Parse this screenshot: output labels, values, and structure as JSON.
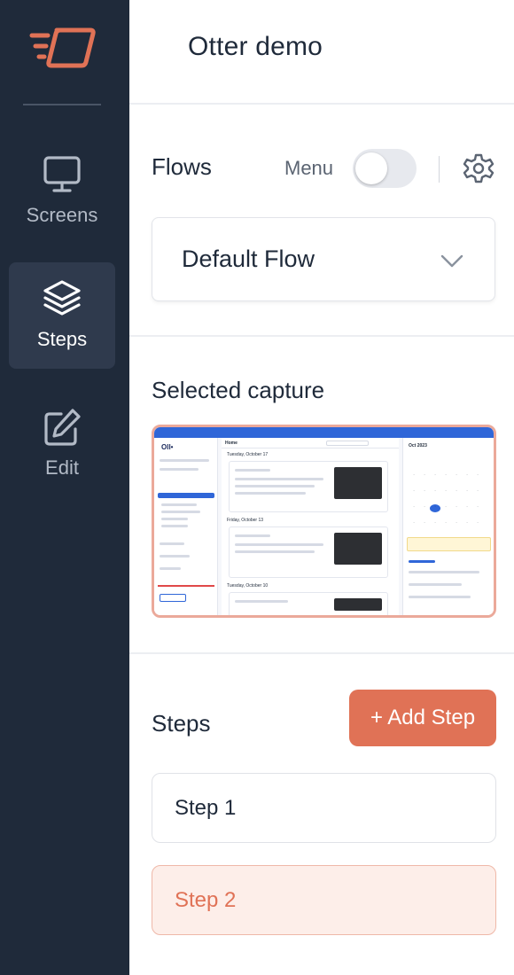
{
  "rail": {
    "items": [
      {
        "label": "Screens",
        "icon": "monitor-icon",
        "active": false
      },
      {
        "label": "Steps",
        "icon": "layers-icon",
        "active": true
      },
      {
        "label": "Edit",
        "icon": "edit-icon",
        "active": false
      }
    ]
  },
  "header": {
    "title": "Otter demo"
  },
  "flows": {
    "title": "Flows",
    "menu_label": "Menu",
    "menu_toggle_on": false,
    "selected_flow": "Default Flow"
  },
  "capture": {
    "title": "Selected capture",
    "preview": {
      "logo": "Oll•",
      "home": "Home",
      "dates": [
        "Tuesday, October 17",
        "Friday, October 13",
        "Tuesday, October 10"
      ],
      "calendar_month": "Oct 2023"
    }
  },
  "steps": {
    "title": "Steps",
    "add_label": "+ Add Step",
    "items": [
      {
        "label": "Step 1",
        "selected": false
      },
      {
        "label": "Step 2",
        "selected": true
      }
    ]
  },
  "colors": {
    "rail_bg": "#1f2a3a",
    "accent": "#e07256",
    "selected_bg": "#fdeee9"
  }
}
